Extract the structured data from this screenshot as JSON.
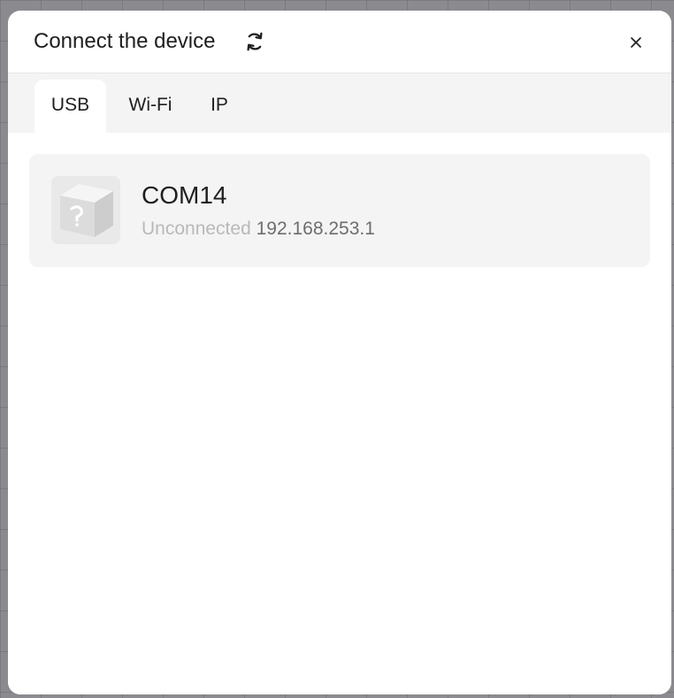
{
  "dialog": {
    "title": "Connect the device",
    "refresh_icon": "refresh-icon",
    "close_icon": "close-icon"
  },
  "tabs": [
    {
      "label": "USB",
      "active": true
    },
    {
      "label": "Wi-Fi",
      "active": false
    },
    {
      "label": "IP",
      "active": false
    }
  ],
  "devices": [
    {
      "name": "COM14",
      "status": "Unconnected",
      "ip": "192.168.253.1",
      "icon": "unknown-device-icon"
    }
  ],
  "colors": {
    "backdrop": "#8a8a8f",
    "panel": "#ffffff",
    "tabbar": "#f4f4f4",
    "card": "#f4f4f4",
    "status_text": "#b9b9b9",
    "ip_text": "#6d6d6d"
  }
}
